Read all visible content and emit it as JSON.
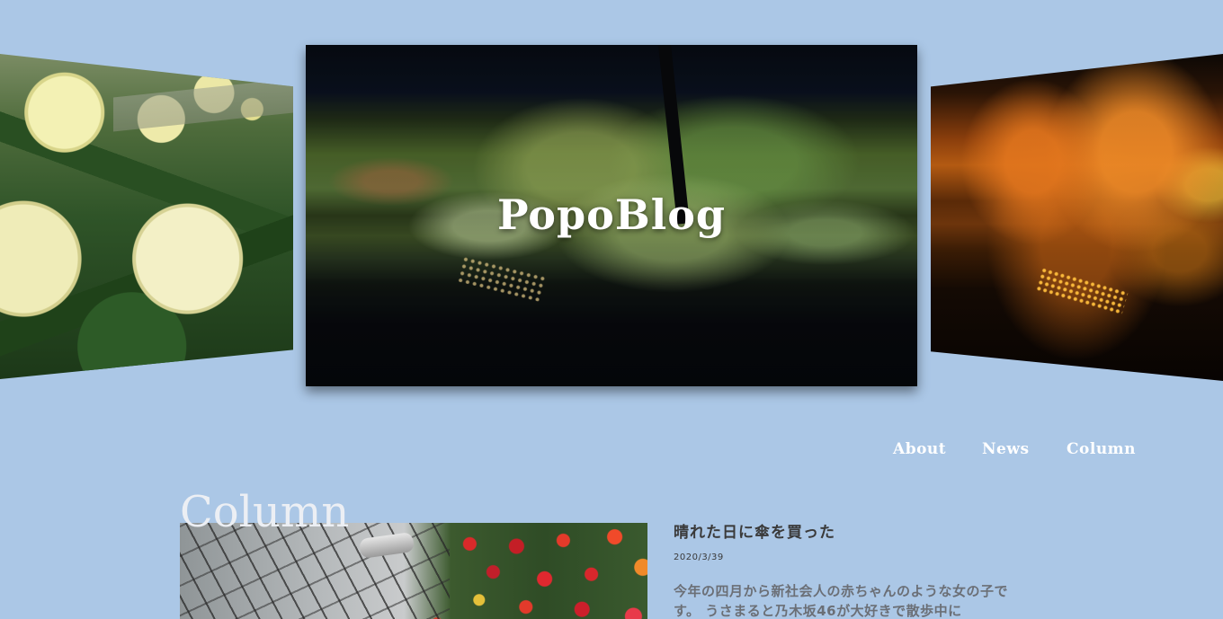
{
  "site": {
    "title": "PopoBlog"
  },
  "hero": {
    "slides": [
      {
        "name": "dahlia-photo"
      },
      {
        "name": "night-garden-photo"
      },
      {
        "name": "autumn-leaves-photo"
      }
    ]
  },
  "nav": {
    "items": [
      {
        "label": "About"
      },
      {
        "label": "News"
      },
      {
        "label": "Column"
      }
    ]
  },
  "column": {
    "section_title": "Column",
    "article": {
      "title": "晴れた日に傘を買った",
      "date": "2020/3/39",
      "excerpt": "今年の四月から新社会人の赤ちゃんのような女の子です。 うさまると乃木坂46が大好きで散歩中に"
    }
  },
  "colors": {
    "background": "#abc7e6",
    "nav_text": "#ffffff",
    "section_title": "#eceff4",
    "article_title": "#3a3a3a",
    "article_excerpt": "#6b6f76"
  }
}
